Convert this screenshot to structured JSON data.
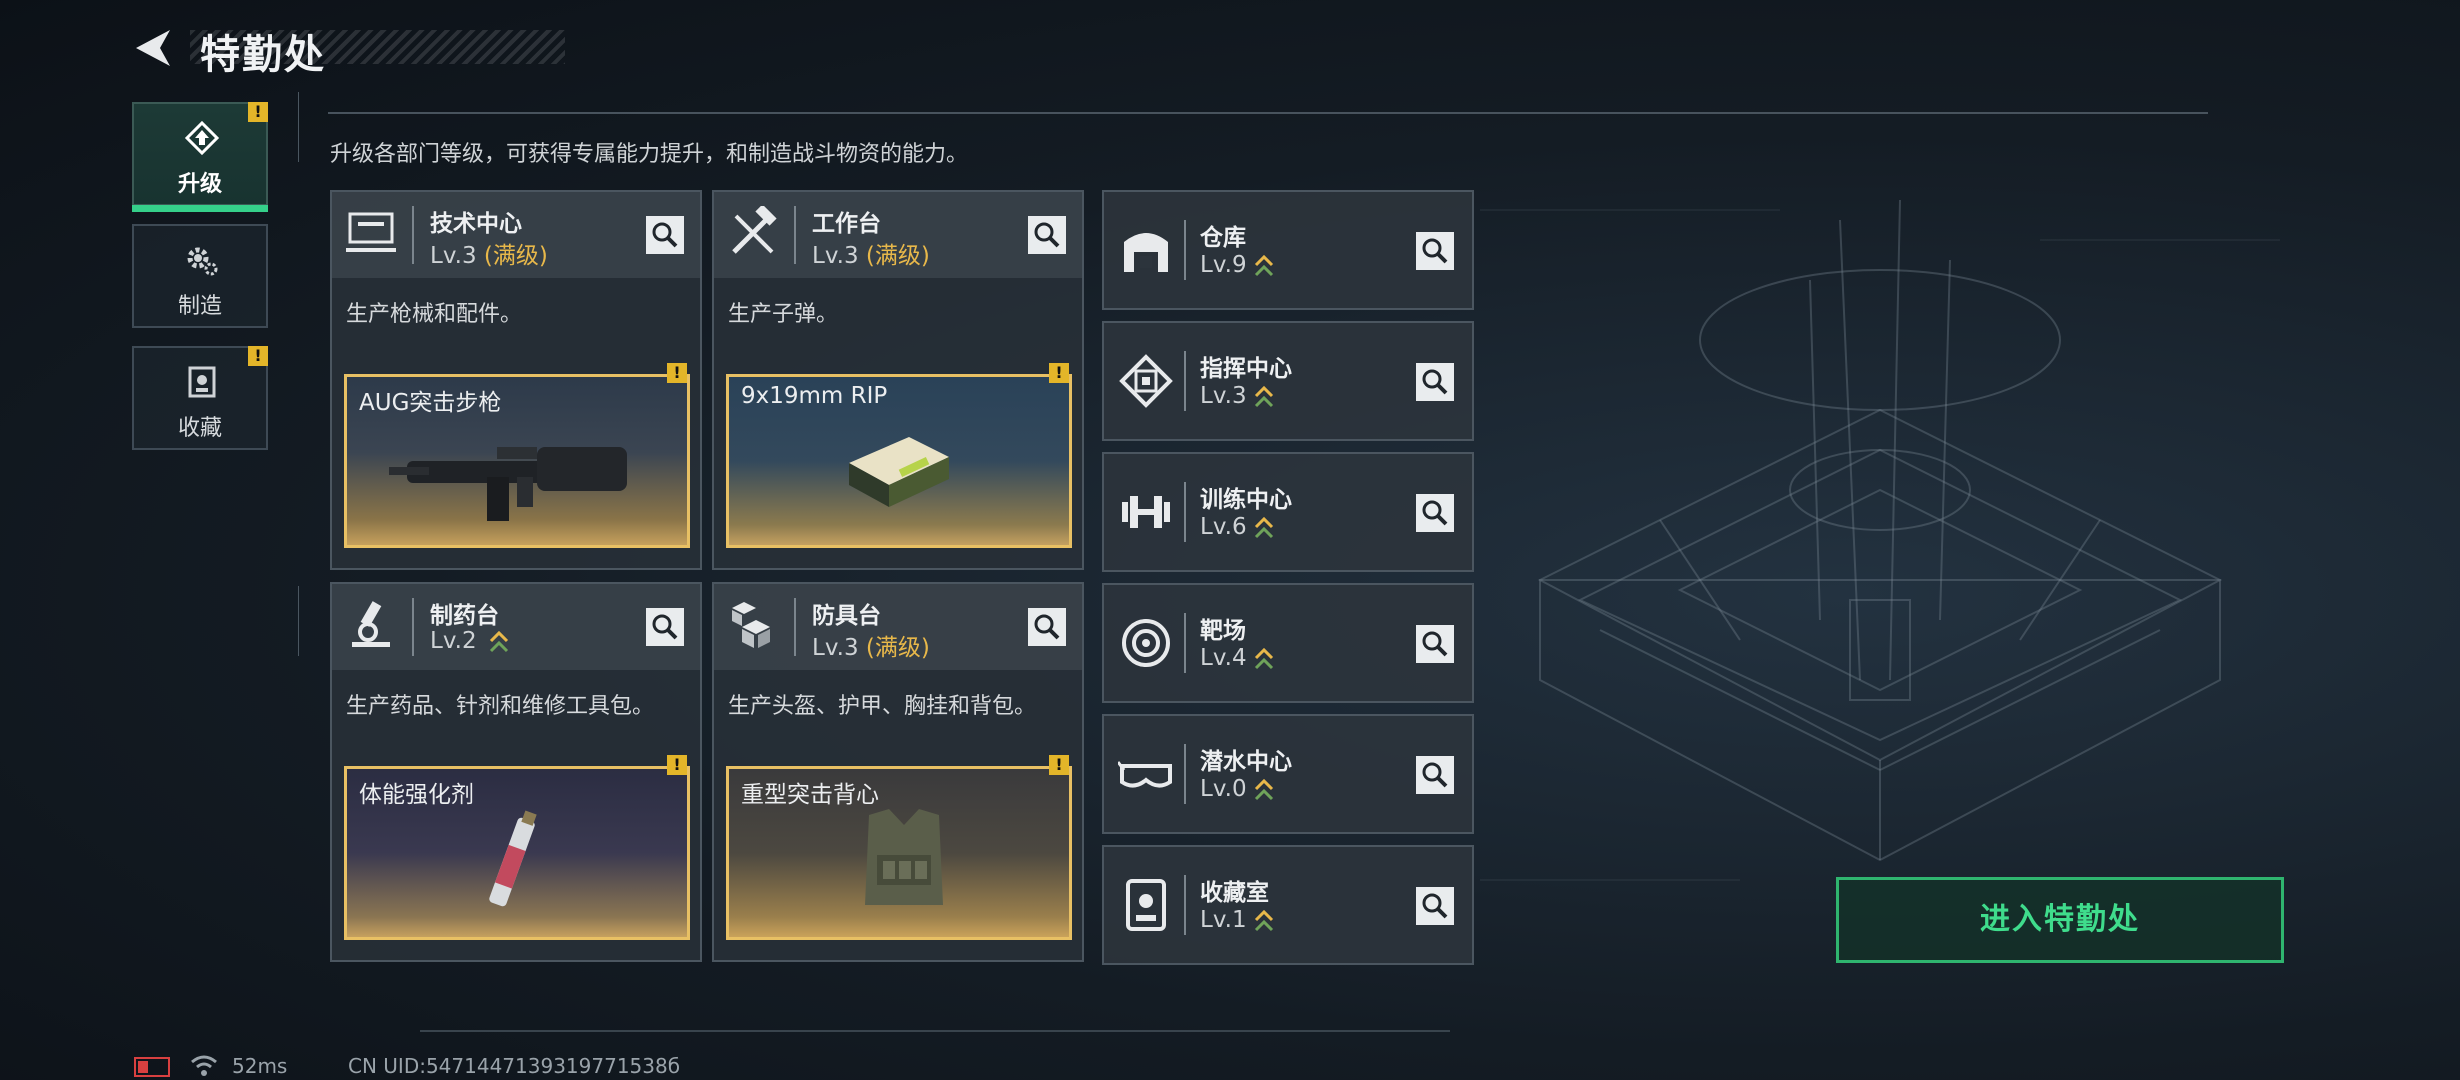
{
  "header": {
    "title": "特勤处"
  },
  "nav": [
    {
      "label": "升级",
      "active": true,
      "warn": "!",
      "icon": "upgrade-icon"
    },
    {
      "label": "制造",
      "active": false,
      "warn": "",
      "icon": "gear-icon"
    },
    {
      "label": "收藏",
      "active": false,
      "warn": "!",
      "icon": "collection-icon"
    }
  ],
  "intro": "升级各部门等级，可获得专属能力提升，和制造战斗物资的能力。",
  "cards": [
    {
      "name": "技术中心",
      "level": "Lv.3",
      "max": "(满级)",
      "desc": "生产枪械和配件。",
      "item": "AUG突击步枪",
      "warn": "!",
      "icon": "computer-icon"
    },
    {
      "name": "工作台",
      "level": "Lv.3",
      "max": "(满级)",
      "desc": "生产子弹。",
      "item": "9x19mm RIP",
      "warn": "!",
      "icon": "tools-icon"
    },
    {
      "name": "制药台",
      "level": "Lv.2",
      "max": "",
      "desc": "生产药品、针剂和维修工具包。",
      "item": "体能强化剂",
      "warn": "!",
      "icon": "microscope-icon"
    },
    {
      "name": "防具台",
      "level": "Lv.3",
      "max": "(满级)",
      "desc": "生产头盔、护甲、胸挂和背包。",
      "item": "重型突击背心",
      "warn": "!",
      "icon": "armor-blocks-icon"
    }
  ],
  "departments": [
    {
      "name": "仓库",
      "level": "Lv.9",
      "icon": "warehouse-icon"
    },
    {
      "name": "指挥中心",
      "level": "Lv.3",
      "icon": "command-icon"
    },
    {
      "name": "训练中心",
      "level": "Lv.6",
      "icon": "dumbbell-icon"
    },
    {
      "name": "靶场",
      "level": "Lv.4",
      "icon": "target-icon"
    },
    {
      "name": "潜水中心",
      "level": "Lv.0",
      "icon": "goggles-icon"
    },
    {
      "name": "收藏室",
      "level": "Lv.1",
      "icon": "collection-icon"
    }
  ],
  "enter_button": "进入特勤处",
  "status": {
    "ping": "52ms",
    "uid": "CN UID:5471447139319771538б"
  },
  "colors": {
    "accent": "#35d08a",
    "warn": "#e3b529",
    "max_level": "#e8b84a"
  }
}
